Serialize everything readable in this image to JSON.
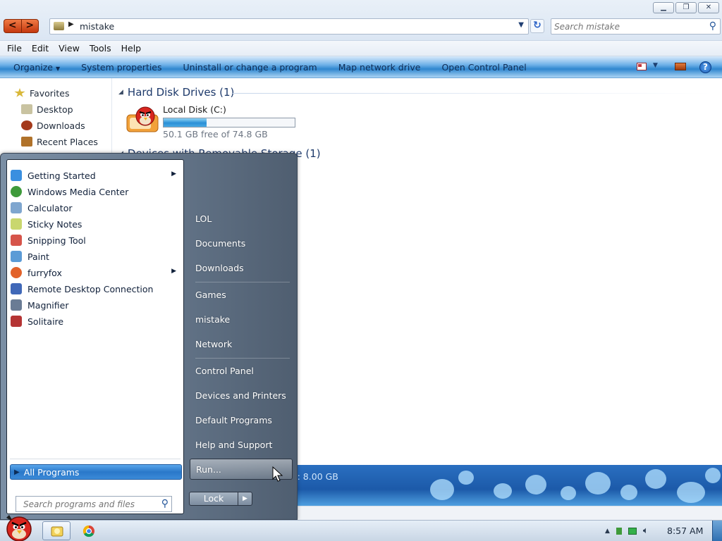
{
  "window": {
    "address": {
      "path": "mistake"
    },
    "search": {
      "placeholder": "Search mistake"
    },
    "menu": [
      "File",
      "Edit",
      "View",
      "Tools",
      "Help"
    ],
    "commands": [
      "Organize",
      "System properties",
      "Uninstall or change a program",
      "Map network drive",
      "Open Control Panel"
    ],
    "organize_arrow": "▼"
  },
  "nav": {
    "items": [
      {
        "label": "Favorites",
        "icon": "star-icon",
        "color": "#d9b83a"
      },
      {
        "label": "Desktop",
        "icon": "desktop-icon",
        "color": "#c9c3a1"
      },
      {
        "label": "Downloads",
        "icon": "downloads-icon",
        "color": "#a43a1c"
      },
      {
        "label": "Recent Places",
        "icon": "recent-places-icon",
        "color": "#b0722a"
      }
    ]
  },
  "content": {
    "groups": [
      {
        "title": "Hard Disk Drives (1)"
      },
      {
        "title": "Devices with Removable Storage (1)"
      }
    ],
    "drive": {
      "name": "Local Disk (C:)",
      "free_text": "50.1 GB free of 74.8 GB",
      "used_fraction": 0.33
    },
    "details": {
      "memory_text": "ry: 8.00 GB"
    }
  },
  "start_menu": {
    "programs": [
      {
        "label": "Getting Started",
        "icon": "getting-started-icon",
        "color": "#3a8fe0",
        "submenu": true
      },
      {
        "label": "Windows Media Center",
        "icon": "media-center-icon",
        "color": "#3e9a3b",
        "submenu": false
      },
      {
        "label": "Calculator",
        "icon": "calculator-icon",
        "color": "#7fa6cf",
        "submenu": false
      },
      {
        "label": "Sticky Notes",
        "icon": "sticky-notes-icon",
        "color": "#c9d76e",
        "submenu": false
      },
      {
        "label": "Snipping Tool",
        "icon": "snipping-tool-icon",
        "color": "#d6544a",
        "submenu": false
      },
      {
        "label": "Paint",
        "icon": "paint-icon",
        "color": "#5b9bd6",
        "submenu": false
      },
      {
        "label": "furryfox",
        "icon": "furryfox-icon",
        "color": "#e2622a",
        "submenu": true
      },
      {
        "label": "Remote Desktop Connection",
        "icon": "remote-desktop-icon",
        "color": "#4068b8",
        "submenu": false
      },
      {
        "label": "Magnifier",
        "icon": "magnifier-icon",
        "color": "#6a7c95",
        "submenu": false
      },
      {
        "label": "Solitaire",
        "icon": "solitaire-icon",
        "color": "#b53434",
        "submenu": false
      }
    ],
    "all_programs": "All Programs",
    "search_placeholder": "Search programs and files",
    "places": [
      {
        "label": "LOL"
      },
      {
        "label": "Documents"
      },
      {
        "label": "Downloads"
      },
      {
        "label": "Games"
      },
      {
        "label": "mistake"
      },
      {
        "label": "Network"
      },
      {
        "label": "Control Panel"
      },
      {
        "label": "Devices and Printers"
      },
      {
        "label": "Default Programs"
      },
      {
        "label": "Help and Support"
      },
      {
        "label": "Run..."
      }
    ],
    "lock_label": "Lock"
  },
  "taskbar": {
    "clock": "8:57 AM"
  },
  "colors": {
    "command_bar": "#2f86cf",
    "all_programs_highlight": "#2a78c9",
    "start_menu_right": "#6b7d92"
  }
}
